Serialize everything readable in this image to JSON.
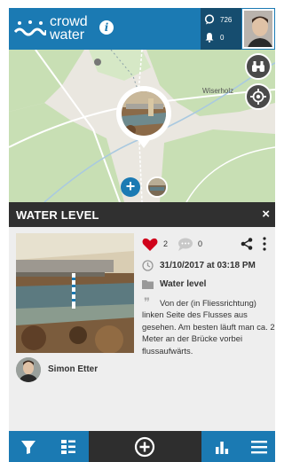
{
  "header": {
    "logo_line1": "crowd",
    "logo_line2": "water",
    "info_label": "i",
    "points_count": "726",
    "notifications_count": "0"
  },
  "map": {
    "place_label": "Wiserholz",
    "add_button_label": "+"
  },
  "panel": {
    "title": "WATER LEVEL",
    "close_label": "×",
    "likes_count": "2",
    "comments_count": "0",
    "date": "31/10/2017 at 03:18 PM",
    "category": "Water level",
    "description": "Von der (in Fliessrichtung) linken Seite des Flusses aus gesehen. Am besten läuft man ca. 2 Meter an der Brücke vorbei flussaufwärts.",
    "author": "Simon Etter"
  },
  "bottom_nav": {
    "items": [
      "filter-icon",
      "list-icon",
      "add-contribution-icon",
      "stats-icon",
      "menu-icon"
    ]
  },
  "colors": {
    "brand_blue": "#1b7ab3",
    "dark_header": "#303030",
    "like_red": "#d0021b"
  }
}
